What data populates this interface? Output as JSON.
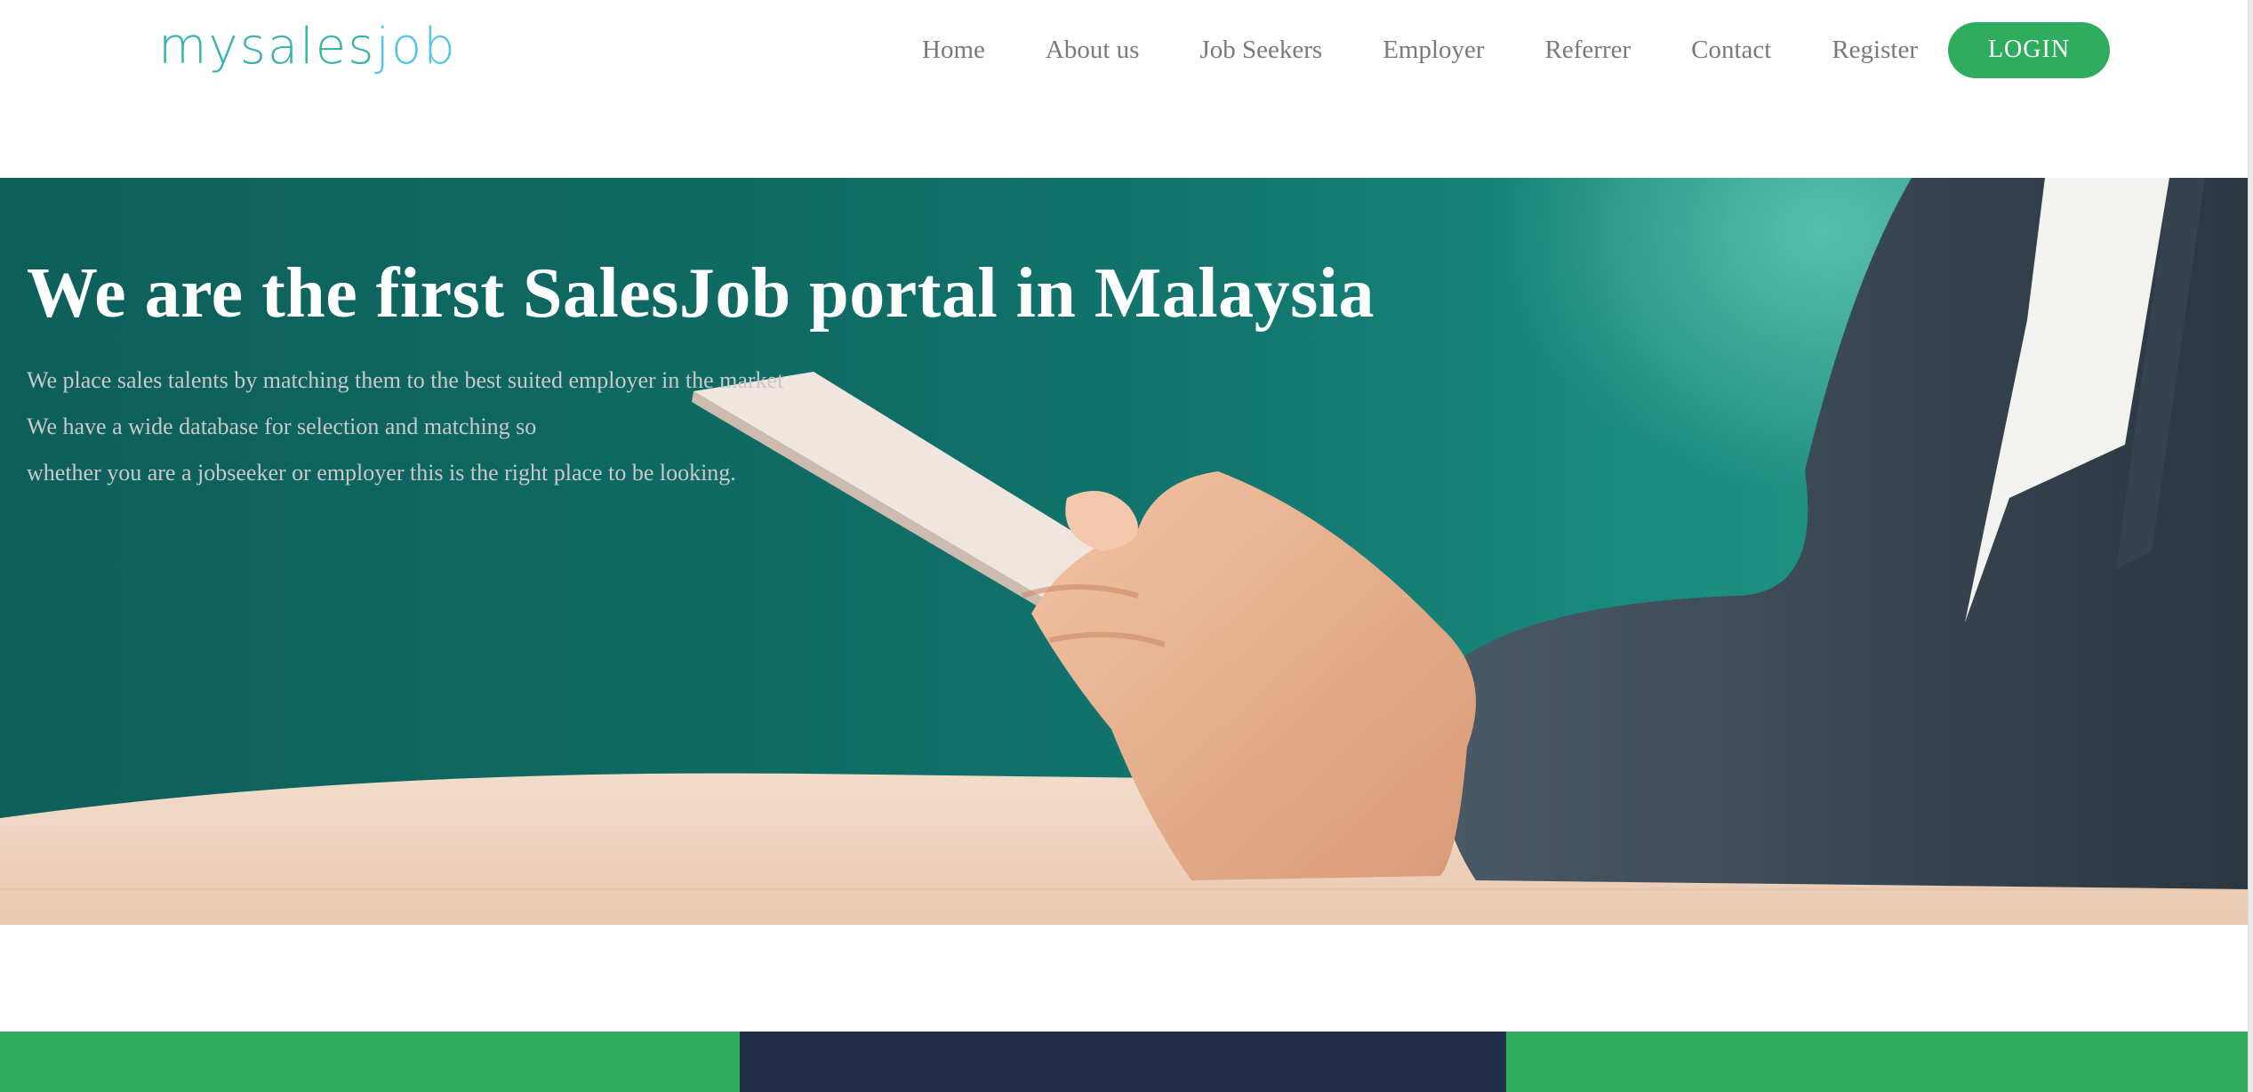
{
  "header": {
    "logo": {
      "part1": "mysales",
      "part2": "job"
    },
    "nav": [
      "Home",
      "About us",
      "Job Seekers",
      "Employer",
      "Referrer",
      "Contact",
      "Register"
    ],
    "login_label": "LOGIN"
  },
  "hero": {
    "title": "We are the first SalesJob portal in Malaysia",
    "lines": [
      "We place sales talents by matching them to the best suited employer in the market",
      "We have a wide database for selection and matching so",
      "whether you are a jobseeker or employer this is the right place to be looking."
    ]
  },
  "colors": {
    "accent_green": "#2fad5f",
    "dark_navy": "#232f49",
    "hero_teal": "#0f6b64",
    "logo_teal": "#3bb3ad",
    "logo_blue": "#55c4ea"
  }
}
